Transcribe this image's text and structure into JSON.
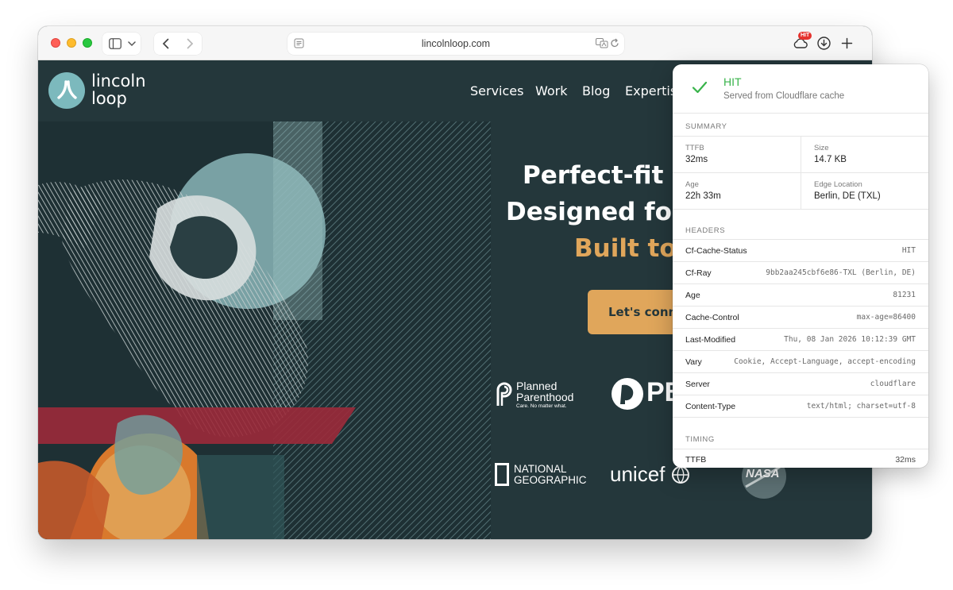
{
  "browser": {
    "url": "lincolnloop.com",
    "extension_badge": "HIT"
  },
  "site": {
    "logo_line1": "lincoln",
    "logo_line2": "loop",
    "nav": [
      "Services",
      "Work",
      "Blog",
      "Expertis"
    ],
    "hero_line1": "Perfect-fit s",
    "hero_line2": "Designed for",
    "hero_line3": "Built to",
    "cta_label": "Let's conn",
    "clients": {
      "planned_parenthood_1": "Planned",
      "planned_parenthood_2": "Parenthood",
      "planned_parenthood_tag": "Care. No matter what.",
      "pbs": "PB",
      "natgeo_1": "NATIONAL",
      "natgeo_2": "GEOGRAPHIC",
      "unicef": "unicef",
      "nasa": "NASA"
    }
  },
  "popover": {
    "status": "HIT",
    "subtitle": "Served from Cloudflare cache",
    "summary_title": "SUMMARY",
    "summary": {
      "ttfb_label": "TTFB",
      "ttfb_value": "32ms",
      "size_label": "Size",
      "size_value": "14.7 KB",
      "age_label": "Age",
      "age_value": "22h 33m",
      "edge_label": "Edge Location",
      "edge_value": "Berlin, DE (TXL)"
    },
    "headers_title": "HEADERS",
    "headers": [
      {
        "name": "Cf-Cache-Status",
        "value": "HIT"
      },
      {
        "name": "Cf-Ray",
        "value": "9bb2aa245cbf6e86-TXL (Berlin, DE)"
      },
      {
        "name": "Age",
        "value": "81231"
      },
      {
        "name": "Cache-Control",
        "value": "max-age=86400"
      },
      {
        "name": "Last-Modified",
        "value": "Thu, 08 Jan 2026 10:12:39 GMT"
      },
      {
        "name": "Vary",
        "value": "Cookie, Accept-Language, accept-encoding"
      },
      {
        "name": "Server",
        "value": "cloudflare"
      },
      {
        "name": "Content-Type",
        "value": "text/html; charset=utf-8"
      }
    ],
    "timing_title": "TIMING",
    "timing": {
      "label": "TTFB",
      "value": "32ms"
    }
  },
  "colors": {
    "page_bg": "#24373b",
    "accent": "#e0a65b",
    "logo_teal": "#7cb9bd",
    "hit_green": "#38b34a",
    "badge_red": "#e5322d"
  }
}
